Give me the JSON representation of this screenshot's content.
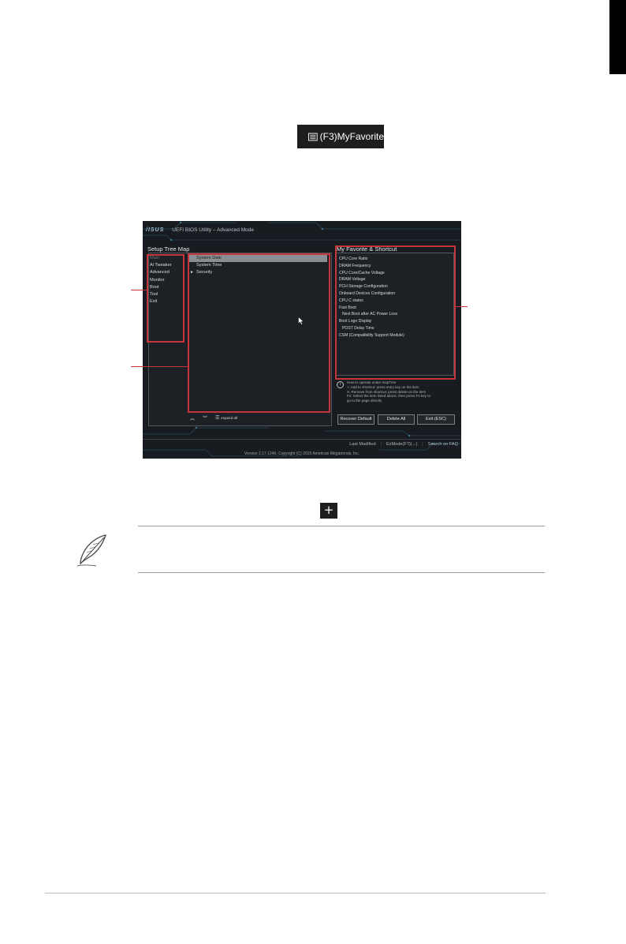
{
  "colors": {
    "callout": "#c7353a",
    "bios_bg": "#181b1f",
    "key_badge_bg": "#1e1e1e"
  },
  "key_badge": {
    "label": "(F3)MyFavorite",
    "icon": "list-icon"
  },
  "bios": {
    "logo": "/ISUS",
    "title": "UEFI BIOS Utility – Advanced Mode",
    "setup_tree_map_label": "Setup Tree Map",
    "menu_items": [
      "Main",
      "Ai Tweaker",
      "Advanced",
      "Monitor",
      "Boot",
      "Tool",
      "Exit"
    ],
    "active_menu": "Main",
    "submenu_items": [
      "System Date",
      "System Time",
      "Security"
    ],
    "selected_submenu": "System Date",
    "submenu_arrow_item": "Security",
    "nav": {
      "up_icon": "double-chevron-up-icon",
      "down_icon": "double-chevron-down-icon",
      "expand_icon": "list-icon",
      "expand_label": "expand all"
    },
    "favorites_label": "My Favorite & Shortcut",
    "favorites": [
      "CPU Core Ratio",
      "DRAM Frequency",
      "CPU Core/Cache Voltage",
      "DRAM Voltage",
      "PCH Storage Configuration",
      "Onboard Devices Configuration",
      "CPU C states",
      "Fast Boot",
      "Next Boot after AC Power Loss",
      "Boot Logo Display",
      "POST Delay Time",
      "CSM (Compatibility Support Module)"
    ],
    "help_lines": [
      "How to operate under mapTree",
      "+: Add to shortcut: press entry key on the item",
      "X: Remove from shortcut: press delete on the item",
      "F4: Select the item listed above, then press F4 key to",
      "go to the page directly"
    ],
    "buttons": {
      "recover": "Recover Default",
      "delete": "Delete All",
      "exit": "Exit (ESC)"
    },
    "footer": {
      "last_modified": "Last Modified",
      "ezmode": "EzMode(F7)|→|",
      "search": "Search on FAQ"
    },
    "version": "Version 2.17.1246. Copyright (C) 2015 American Megatrends, Inc."
  },
  "plus_icon": "+",
  "note_icon": "feather-pen-icon"
}
